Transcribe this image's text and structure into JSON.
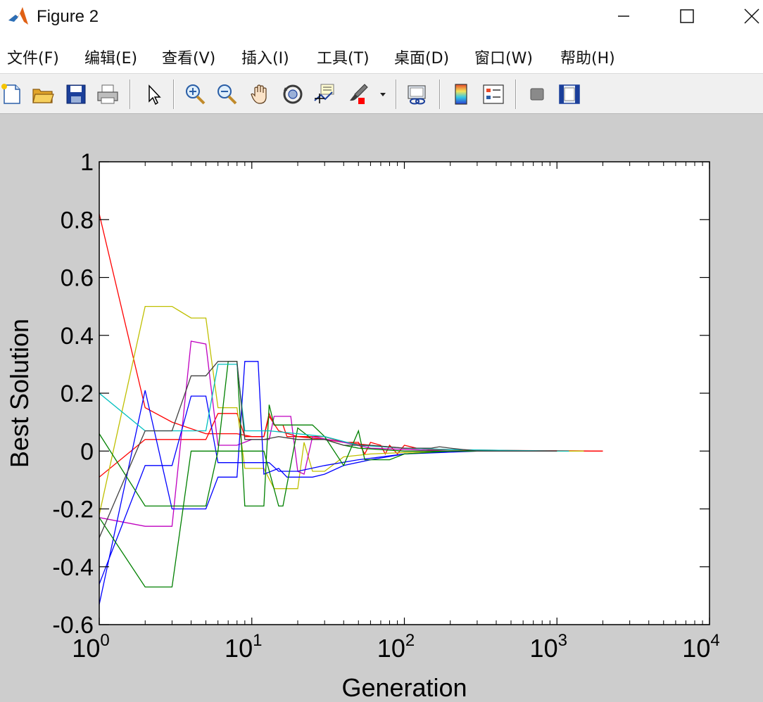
{
  "window": {
    "title": "Figure 2"
  },
  "menu": {
    "items": [
      {
        "label": "文件(F)"
      },
      {
        "label": "编辑(E)"
      },
      {
        "label": "查看(V)"
      },
      {
        "label": "插入(I)"
      },
      {
        "label": "工具(T)"
      },
      {
        "label": "桌面(D)"
      },
      {
        "label": "窗口(W)"
      },
      {
        "label": "帮助(H)"
      }
    ]
  },
  "toolbar": {
    "icons": [
      "new-figure-icon",
      "open-file-icon",
      "save-icon",
      "print-icon",
      "edit-plot-cursor-icon",
      "zoom-in-icon",
      "zoom-out-icon",
      "pan-hand-icon",
      "rotate-3d-icon",
      "data-cursor-icon",
      "brush-icon",
      "brush-dropdown-icon",
      "link-plot-icon",
      "colorbar-icon",
      "legend-icon",
      "hide-plot-tools-icon",
      "show-plot-tools-icon"
    ]
  },
  "chart_data": {
    "type": "line",
    "title": "",
    "xlabel": "Generation",
    "ylabel": "Best Solution",
    "xscale": "log",
    "xlim": [
      1,
      10000
    ],
    "ylim": [
      -0.6,
      1
    ],
    "x_ticks": [
      {
        "base": "10",
        "exp": "0"
      },
      {
        "base": "10",
        "exp": "1"
      },
      {
        "base": "10",
        "exp": "2"
      },
      {
        "base": "10",
        "exp": "3"
      },
      {
        "base": "10",
        "exp": "4"
      }
    ],
    "y_tick_labels": [
      "-0.6",
      "-0.4",
      "-0.2",
      "0",
      "0.2",
      "0.4",
      "0.6",
      "0.8",
      "1"
    ],
    "y_tick_values": [
      -0.6,
      -0.4,
      -0.2,
      0,
      0.2,
      0.4,
      0.6,
      0.8,
      1
    ],
    "grid": false,
    "legend": "none",
    "series": [
      {
        "color": "#ff0000",
        "points": [
          [
            1,
            0.82
          ],
          [
            2,
            0.15
          ],
          [
            3,
            0.1
          ],
          [
            5,
            0.06
          ],
          [
            8,
            0.06
          ],
          [
            10,
            0.05
          ],
          [
            12,
            0.05
          ],
          [
            13,
            0.12
          ],
          [
            15,
            0.07
          ],
          [
            20,
            0.05
          ],
          [
            30,
            0.04
          ],
          [
            40,
            0.03
          ],
          [
            60,
            0.02
          ],
          [
            100,
            0.01
          ],
          [
            200,
            0.005
          ],
          [
            500,
            0.002
          ],
          [
            1000,
            0.001
          ],
          [
            2000,
            0
          ]
        ]
      },
      {
        "color": "#ff0000",
        "points": [
          [
            1,
            -0.09
          ],
          [
            2,
            0.04
          ],
          [
            5,
            0.04
          ],
          [
            6,
            0.13
          ],
          [
            8,
            0.13
          ],
          [
            9,
            0.05
          ],
          [
            12,
            0.05
          ],
          [
            13,
            0.13
          ],
          [
            14,
            0.09
          ],
          [
            16,
            0.09
          ],
          [
            17,
            0.05
          ],
          [
            25,
            0.05
          ],
          [
            30,
            0.05
          ],
          [
            40,
            0.03
          ],
          [
            50,
            0.03
          ],
          [
            55,
            -0.01
          ],
          [
            60,
            0.03
          ],
          [
            70,
            0.02
          ],
          [
            75,
            -0.01
          ],
          [
            80,
            0.02
          ],
          [
            90,
            -0.01
          ],
          [
            100,
            0.02
          ],
          [
            120,
            0.01
          ],
          [
            150,
            0.005
          ],
          [
            400,
            0.002
          ],
          [
            2000,
            0
          ]
        ]
      },
      {
        "color": "#bfbf00",
        "points": [
          [
            1,
            -0.22
          ],
          [
            2,
            0.5
          ],
          [
            3,
            0.5
          ],
          [
            4,
            0.46
          ],
          [
            5,
            0.46
          ],
          [
            6,
            0.15
          ],
          [
            8,
            0.15
          ],
          [
            9,
            -0.06
          ],
          [
            12,
            -0.06
          ],
          [
            14,
            -0.13
          ],
          [
            20,
            -0.13
          ],
          [
            22,
            0.03
          ],
          [
            25,
            -0.07
          ],
          [
            30,
            -0.07
          ],
          [
            40,
            -0.02
          ],
          [
            60,
            -0.01
          ],
          [
            100,
            -0.005
          ],
          [
            300,
            0
          ],
          [
            1500,
            0
          ]
        ]
      },
      {
        "color": "#bf00bf",
        "points": [
          [
            1,
            -0.23
          ],
          [
            2,
            -0.26
          ],
          [
            3,
            -0.26
          ],
          [
            4,
            0.38
          ],
          [
            5,
            0.37
          ],
          [
            6,
            0.02
          ],
          [
            8,
            0.02
          ],
          [
            10,
            0.04
          ],
          [
            13,
            0.04
          ],
          [
            14,
            0.12
          ],
          [
            18,
            0.12
          ],
          [
            20,
            -0.07
          ],
          [
            22,
            -0.08
          ],
          [
            25,
            0.05
          ],
          [
            40,
            0.03
          ],
          [
            60,
            0.01
          ],
          [
            200,
            0
          ],
          [
            1000,
            0
          ]
        ]
      },
      {
        "color": "#0000ff",
        "points": [
          [
            1,
            -0.53
          ],
          [
            2,
            0.21
          ],
          [
            3,
            -0.2
          ],
          [
            5,
            -0.2
          ],
          [
            6,
            -0.09
          ],
          [
            8,
            -0.09
          ],
          [
            9,
            0.31
          ],
          [
            11,
            0.31
          ],
          [
            12,
            -0.08
          ],
          [
            15,
            -0.06
          ],
          [
            17,
            -0.09
          ],
          [
            25,
            -0.09
          ],
          [
            30,
            -0.08
          ],
          [
            40,
            -0.05
          ],
          [
            60,
            -0.03
          ],
          [
            100,
            -0.01
          ],
          [
            300,
            0
          ],
          [
            1000,
            0
          ]
        ]
      },
      {
        "color": "#0000ff",
        "points": [
          [
            1,
            -0.46
          ],
          [
            2,
            -0.05
          ],
          [
            3,
            -0.05
          ],
          [
            4,
            0.19
          ],
          [
            5,
            0.19
          ],
          [
            6,
            -0.04
          ],
          [
            8,
            -0.04
          ],
          [
            10,
            -0.04
          ],
          [
            13,
            -0.04
          ],
          [
            15,
            -0.07
          ],
          [
            20,
            -0.07
          ],
          [
            30,
            -0.05
          ],
          [
            50,
            -0.03
          ],
          [
            100,
            -0.01
          ],
          [
            200,
            0
          ],
          [
            800,
            0
          ]
        ]
      },
      {
        "color": "#008000",
        "points": [
          [
            1,
            -0.23
          ],
          [
            2,
            -0.47
          ],
          [
            3,
            -0.47
          ],
          [
            4,
            0
          ],
          [
            6,
            0
          ],
          [
            7,
            0.31
          ],
          [
            8,
            0.31
          ],
          [
            9,
            -0.19
          ],
          [
            12,
            -0.19
          ],
          [
            13,
            0.16
          ],
          [
            14,
            0.09
          ],
          [
            18,
            0.09
          ],
          [
            25,
            0.09
          ],
          [
            30,
            0.05
          ],
          [
            40,
            -0.05
          ],
          [
            50,
            0.07
          ],
          [
            55,
            -0.03
          ],
          [
            80,
            -0.03
          ],
          [
            100,
            -0.01
          ],
          [
            200,
            0
          ],
          [
            1000,
            0
          ]
        ]
      },
      {
        "color": "#008000",
        "points": [
          [
            1,
            0.06
          ],
          [
            2,
            -0.19
          ],
          [
            3,
            -0.19
          ],
          [
            5,
            -0.19
          ],
          [
            6,
            0
          ],
          [
            8,
            0
          ],
          [
            12,
            0
          ],
          [
            15,
            -0.19
          ],
          [
            16,
            -0.19
          ],
          [
            20,
            0.08
          ],
          [
            25,
            0.04
          ],
          [
            30,
            0.04
          ],
          [
            40,
            0.02
          ],
          [
            50,
            0.01
          ],
          [
            100,
            0
          ],
          [
            500,
            0
          ]
        ]
      },
      {
        "color": "#00bfbf",
        "points": [
          [
            1,
            0.2
          ],
          [
            2,
            0.07
          ],
          [
            5,
            0.07
          ],
          [
            6,
            0.3
          ],
          [
            8,
            0.3
          ],
          [
            9,
            0.07
          ],
          [
            13,
            0.07
          ],
          [
            20,
            0.06
          ],
          [
            30,
            0.05
          ],
          [
            50,
            0.02
          ],
          [
            100,
            0.01
          ],
          [
            200,
            0.005
          ],
          [
            500,
            0.002
          ],
          [
            1200,
            0
          ]
        ]
      },
      {
        "color": "#404040",
        "points": [
          [
            1,
            -0.3
          ],
          [
            2,
            0.07
          ],
          [
            3,
            0.07
          ],
          [
            4,
            0.26
          ],
          [
            5,
            0.26
          ],
          [
            6,
            0.31
          ],
          [
            8,
            0.31
          ],
          [
            9,
            0.04
          ],
          [
            12,
            0.04
          ],
          [
            15,
            0.05
          ],
          [
            20,
            0.04
          ],
          [
            30,
            0.04
          ],
          [
            40,
            0.02
          ],
          [
            60,
            0.02
          ],
          [
            100,
            0.01
          ],
          [
            150,
            0.01
          ],
          [
            170,
            0.015
          ],
          [
            200,
            0.01
          ],
          [
            300,
            0
          ],
          [
            1000,
            0
          ]
        ]
      }
    ]
  }
}
